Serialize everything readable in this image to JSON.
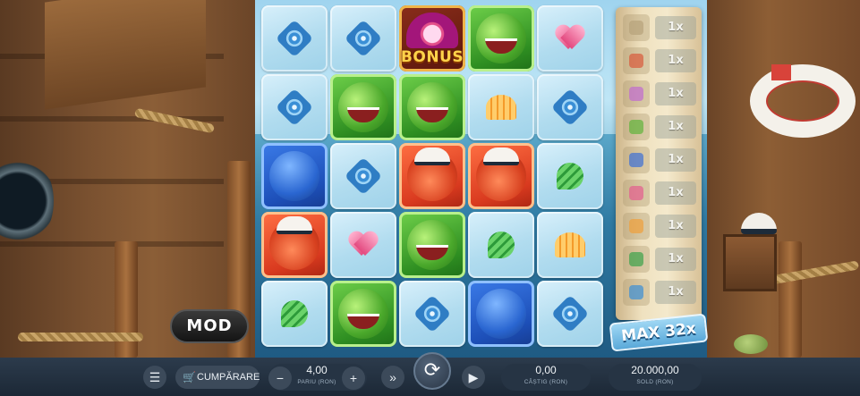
{
  "grid": [
    [
      "spiral",
      "spiral",
      "bonus",
      "frog",
      "heart"
    ],
    [
      "spiral",
      "frog",
      "frog",
      "shell",
      "spiral"
    ],
    [
      "blue",
      "spiral",
      "red",
      "red",
      "conch"
    ],
    [
      "red",
      "heart",
      "frog",
      "conch",
      "shell"
    ],
    [
      "conch",
      "frog",
      "spiral",
      "blue",
      "spiral"
    ]
  ],
  "bonus_label": "BONUS",
  "paytable": {
    "rows": [
      {
        "symbol": "blank-icon",
        "mult": "1x",
        "color": "#b7a27a"
      },
      {
        "symbol": "captain-icon",
        "mult": "1x",
        "color": "#d85a3a"
      },
      {
        "symbol": "octopus-icon",
        "mult": "1x",
        "color": "#c06bd0"
      },
      {
        "symbol": "frog-icon",
        "mult": "1x",
        "color": "#5fb33a"
      },
      {
        "symbol": "blue-monster-icon",
        "mult": "1x",
        "color": "#3c6fd6"
      },
      {
        "symbol": "heart-icon",
        "mult": "1x",
        "color": "#e45d8f"
      },
      {
        "symbol": "shell-icon",
        "mult": "1x",
        "color": "#f0a03a"
      },
      {
        "symbol": "conch-icon",
        "mult": "1x",
        "color": "#3aa34a"
      },
      {
        "symbol": "spiral-icon",
        "mult": "1x",
        "color": "#3a8fd6"
      }
    ]
  },
  "max_label": "MAX 32x",
  "mod_label": "MOD",
  "bar": {
    "buy_label": "CUMPĂRARE",
    "bet_value": "4,00",
    "bet_label": "PARIU (RON)",
    "win_value": "0,00",
    "win_label": "CÂȘTIG (RON)",
    "balance_value": "20.000,00",
    "balance_label": "SOLD (RON)"
  }
}
